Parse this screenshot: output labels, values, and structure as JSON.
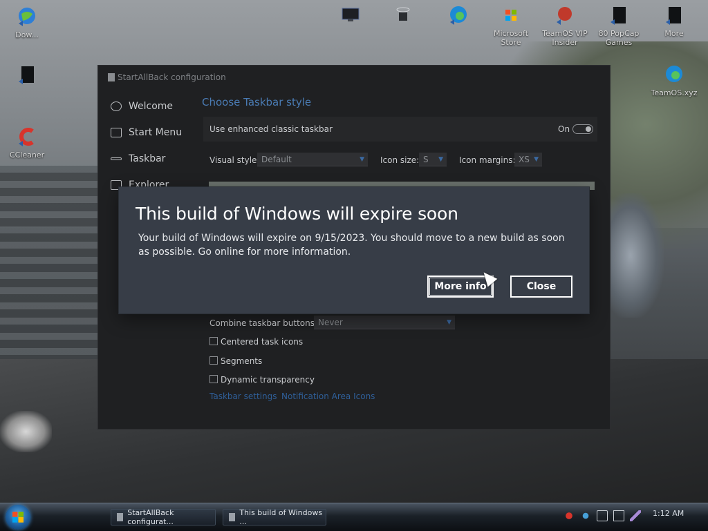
{
  "desktop": {
    "icons": [
      {
        "label": "Dow..."
      },
      {
        "label": ""
      },
      {
        "label": "CCleaner"
      },
      {
        "label": ""
      },
      {
        "label": ""
      },
      {
        "label": ""
      },
      {
        "label": "Microsoft Store"
      },
      {
        "label": "TeamOS VIP Insider"
      },
      {
        "label": "80 PopCap Games"
      },
      {
        "label": "More"
      },
      {
        "label": "TeamOS.xyz"
      }
    ]
  },
  "sab": {
    "title": "StartAllBack configuration",
    "nav": [
      {
        "label": "Welcome"
      },
      {
        "label": "Start Menu"
      },
      {
        "label": "Taskbar"
      },
      {
        "label": "Explorer"
      }
    ],
    "section_title": "Choose Taskbar style",
    "enhanced_label": "Use enhanced classic taskbar",
    "enhanced_state": "On",
    "visual_style_label": "Visual style:",
    "visual_style_value": "Default",
    "icon_size_label": "Icon size:",
    "icon_size_value": "S",
    "icon_margins_label": "Icon margins:",
    "icon_margins_value": "XS",
    "combine_label": "Combine taskbar buttons:",
    "combine_value": "Never",
    "checkboxes": [
      {
        "label": "Centered task icons",
        "checked": false
      },
      {
        "label": "Segments",
        "checked": false
      },
      {
        "label": "Dynamic transparency",
        "checked": false
      }
    ],
    "link_taskbar_settings": "Taskbar settings",
    "link_notification": "Notification Area Icons"
  },
  "dialog": {
    "title": "This build of Windows will expire soon",
    "message": "Your build of Windows will expire on 9/15/2023. You should move to a new build as soon as possible. Go online for more information.",
    "more_info": "More info",
    "close": "Close"
  },
  "taskbar": {
    "tasks": [
      {
        "label": "StartAllBack configurat..."
      },
      {
        "label": "This build of Windows ..."
      }
    ],
    "clock": "1:12 AM"
  },
  "colors": {
    "dialog_bg": "#373d47",
    "link_blue": "#2f5f99",
    "section_title": "#4a7bb3"
  }
}
